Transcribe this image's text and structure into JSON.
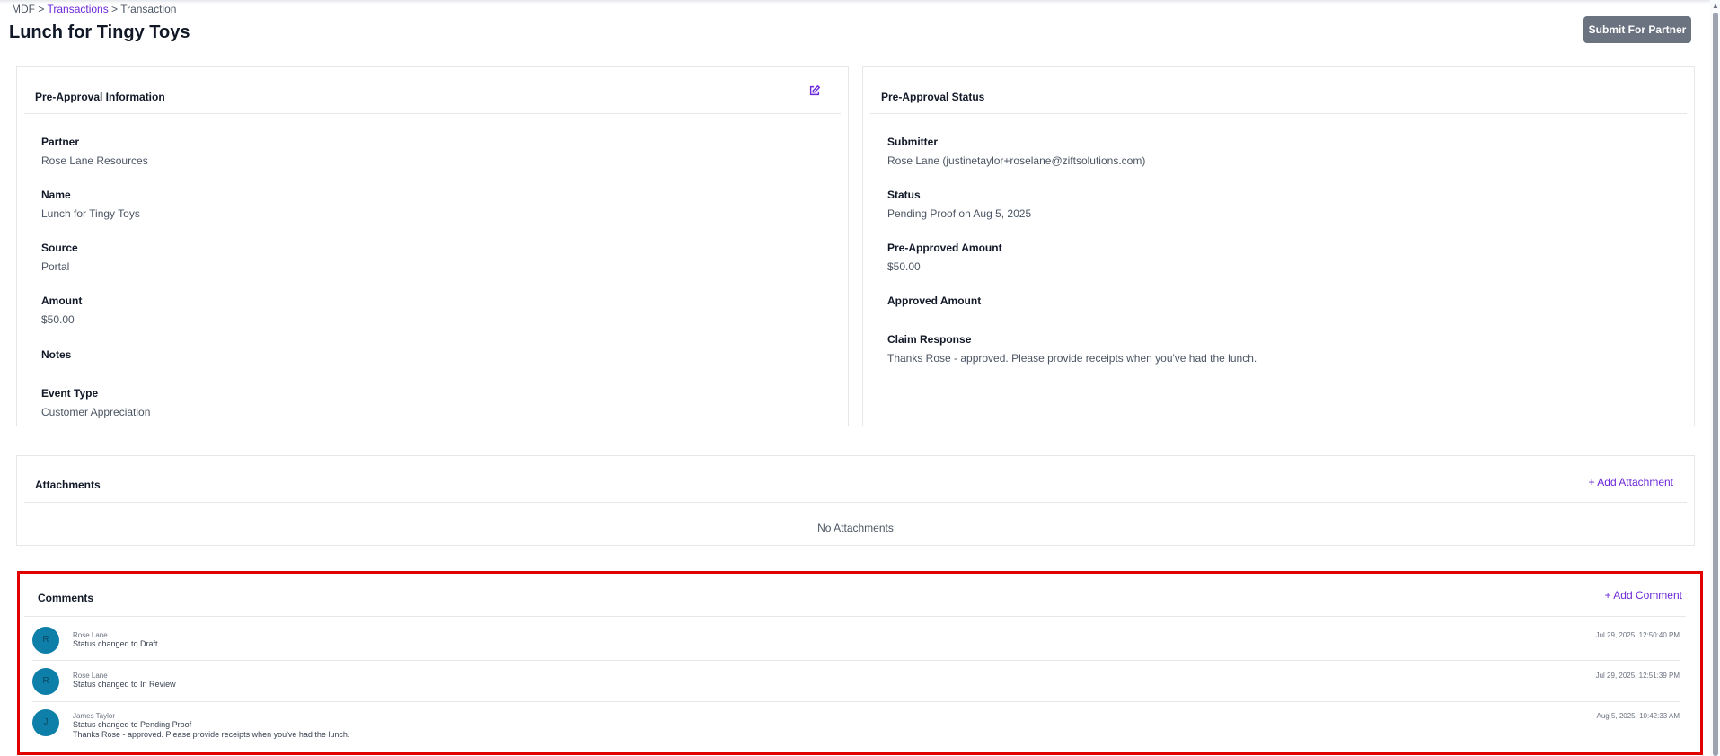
{
  "breadcrumb": {
    "root": "MDF",
    "sep1": " > ",
    "transactions": "Transactions",
    "sep2": " > ",
    "current": "Transaction"
  },
  "page_title": "Lunch for Tingy Toys",
  "submit_button": "Submit For Partner",
  "pre_approval_info": {
    "title": "Pre-Approval Information",
    "fields": [
      {
        "label": "Partner",
        "value": "Rose Lane Resources"
      },
      {
        "label": "Name",
        "value": "Lunch for Tingy Toys"
      },
      {
        "label": "Source",
        "value": "Portal"
      },
      {
        "label": "Amount",
        "value": "$50.00"
      },
      {
        "label": "Notes",
        "value": ""
      },
      {
        "label": "Event Type",
        "value": "Customer Appreciation"
      }
    ]
  },
  "pre_approval_status": {
    "title": "Pre-Approval Status",
    "fields": [
      {
        "label": "Submitter",
        "value": "Rose Lane (justinetaylor+roselane@ziftsolutions.com)"
      },
      {
        "label": "Status",
        "value": "Pending Proof on Aug 5, 2025"
      },
      {
        "label": "Pre-Approved Amount",
        "value": "$50.00"
      },
      {
        "label": "Approved Amount",
        "value": ""
      },
      {
        "label": "Claim Response",
        "value": "Thanks Rose - approved. Please provide receipts when you've had the lunch."
      }
    ]
  },
  "attachments": {
    "title": "Attachments",
    "add_label": "+ Add Attachment",
    "empty_text": "No Attachments"
  },
  "comments": {
    "title": "Comments",
    "add_label": "+ Add Comment",
    "items": [
      {
        "initial": "R",
        "author": "Rose Lane",
        "text": "Status changed to Draft",
        "extra": "",
        "time": "Jul 29, 2025, 12:50:40 PM"
      },
      {
        "initial": "R",
        "author": "Rose Lane",
        "text": "Status changed to In Review",
        "extra": "",
        "time": "Jul 29, 2025, 12:51:39 PM"
      },
      {
        "initial": "J",
        "author": "James Taylor",
        "text": "Status changed to Pending Proof",
        "extra": "Thanks Rose - approved. Please provide receipts when you've had the lunch.",
        "time": "Aug 5, 2025, 10:42:33 AM"
      }
    ]
  },
  "colors": {
    "accent": "#6d28d9",
    "button_gray": "#6b7280",
    "avatar": "#0e7fa8",
    "highlight": "#e00000"
  }
}
